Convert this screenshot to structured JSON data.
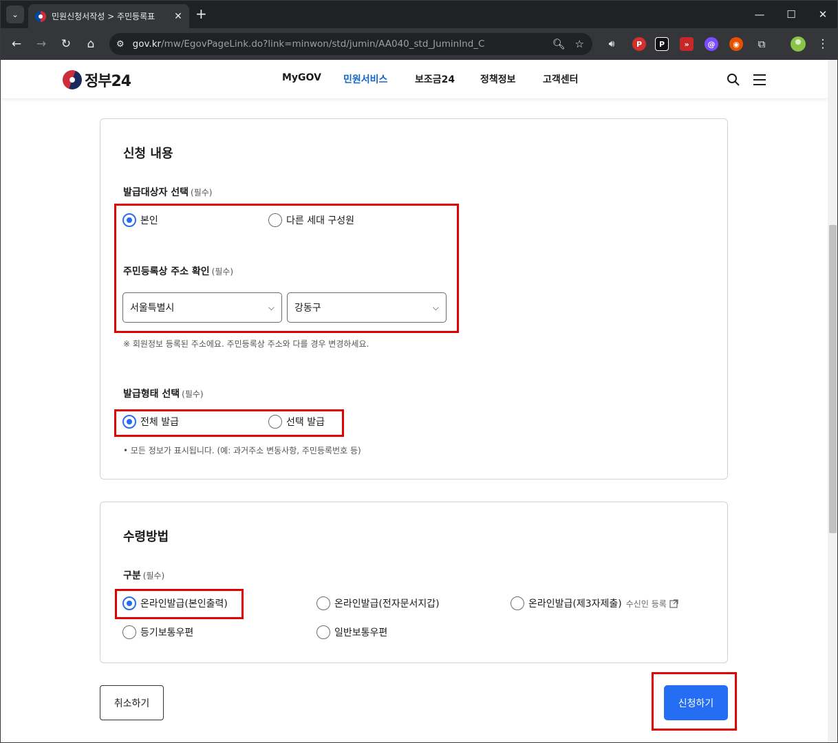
{
  "browser": {
    "tab_title": "민원신청서작성 > 주민등록표",
    "url_host": "gov.kr",
    "url_path": "/mw/EgovPageLink.do?link=minwon/std/jumin/AA040_std_JuminInd_C"
  },
  "site": {
    "logo_text": "정부24",
    "nav": [
      {
        "label": "MyGOV"
      },
      {
        "label": "민원서비스"
      },
      {
        "label": "보조금24"
      },
      {
        "label": "정책정보"
      },
      {
        "label": "고객센터"
      }
    ]
  },
  "application": {
    "title": "신청 내용",
    "target": {
      "label": "발급대상자 선택",
      "required": "(필수)",
      "options": [
        "본인",
        "다른 세대 구성원"
      ],
      "selected": "본인"
    },
    "address": {
      "label": "주민등록상 주소 확인",
      "required": "(필수)",
      "city": "서울특별시",
      "district": "강동구",
      "note": "※ 회원정보 등록된 주소에요. 주민등록상 주소와 다를 경우 변경하세요."
    },
    "issue_type": {
      "label": "발급형태 선택",
      "required": "(필수)",
      "options": [
        "전체 발급",
        "선택 발급"
      ],
      "selected": "전체 발급",
      "note": "• 모든 정보가 표시됩니다. (예: 과거주소 변동사항, 주민등록번호 등)"
    }
  },
  "receipt": {
    "title": "수령방법",
    "label": "구분",
    "required": "(필수)",
    "options": [
      "온라인발급(본인출력)",
      "온라인발급(전자문서지갑)",
      "온라인발급(제3자제출)",
      "등기보통우편",
      "일반보통우편"
    ],
    "selected": "온라인발급(본인출력)",
    "recipient_link": "수신인 등록"
  },
  "buttons": {
    "cancel": "취소하기",
    "submit": "신청하기"
  },
  "colors": {
    "accent": "#256ef4",
    "nav_active": "#1467c8",
    "highlight": "#e00000"
  }
}
